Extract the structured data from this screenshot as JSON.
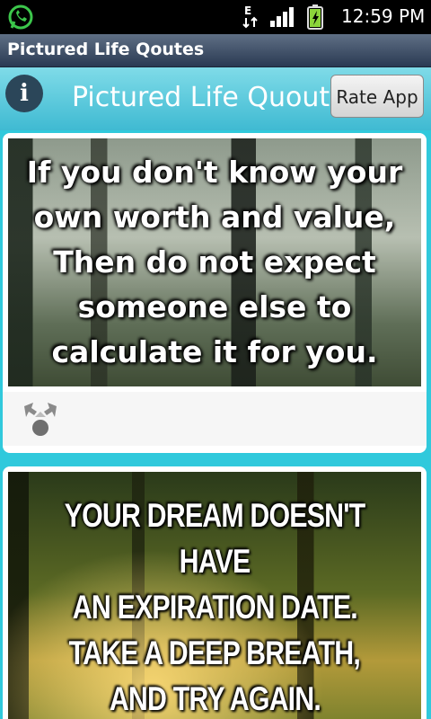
{
  "status_bar": {
    "network_letter": "E",
    "time": "12:59 PM",
    "icons": [
      "whatsapp-icon",
      "network-icon",
      "signal-icon",
      "battery-charging-icon"
    ]
  },
  "app": {
    "title": "Pictured Life Qoutes"
  },
  "header": {
    "info_label": "i",
    "title": "Pictured Life Quoutes",
    "rate_button": "Rate App"
  },
  "feed": {
    "cards": [
      {
        "lines": [
          "If you don't know your",
          "own worth and value,",
          "Then do not expect",
          "someone else to",
          "calculate it for you."
        ],
        "share_icon": "share-icon"
      },
      {
        "lines": [
          "YOUR DREAM DOESN'T HAVE",
          "AN EXPIRATION DATE.",
          "TAKE A DEEP BREATH,",
          "AND TRY AGAIN."
        ]
      }
    ]
  },
  "colors": {
    "header_top": "#7fdbe8",
    "header_bottom": "#3fbad2",
    "feed_bg": "#30c9dc",
    "title_bar": "#2a3a52"
  }
}
